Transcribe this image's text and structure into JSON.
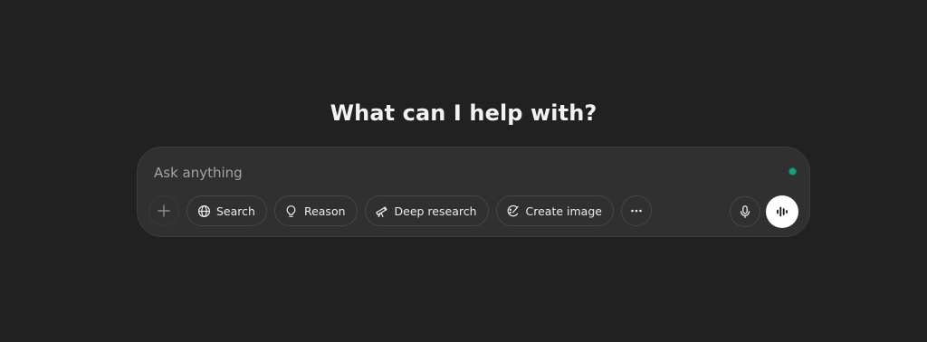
{
  "main": {
    "heading": "What can I help with?"
  },
  "composer": {
    "placeholder": "Ask anything",
    "status_color": "#10a37f",
    "tools": [
      {
        "label": "Search",
        "icon": "globe-icon"
      },
      {
        "label": "Reason",
        "icon": "lightbulb-icon"
      },
      {
        "label": "Deep research",
        "icon": "telescope-icon"
      },
      {
        "label": "Create image",
        "icon": "paint-icon"
      }
    ],
    "more_icon": "ellipsis-icon",
    "attach_icon": "plus-icon",
    "mic_icon": "microphone-icon",
    "voice_icon": "voice-wave-icon"
  },
  "colors": {
    "background": "#212121",
    "composer_bg": "#303030",
    "accent": "#10a37f",
    "voice_button": "#ffffff"
  }
}
